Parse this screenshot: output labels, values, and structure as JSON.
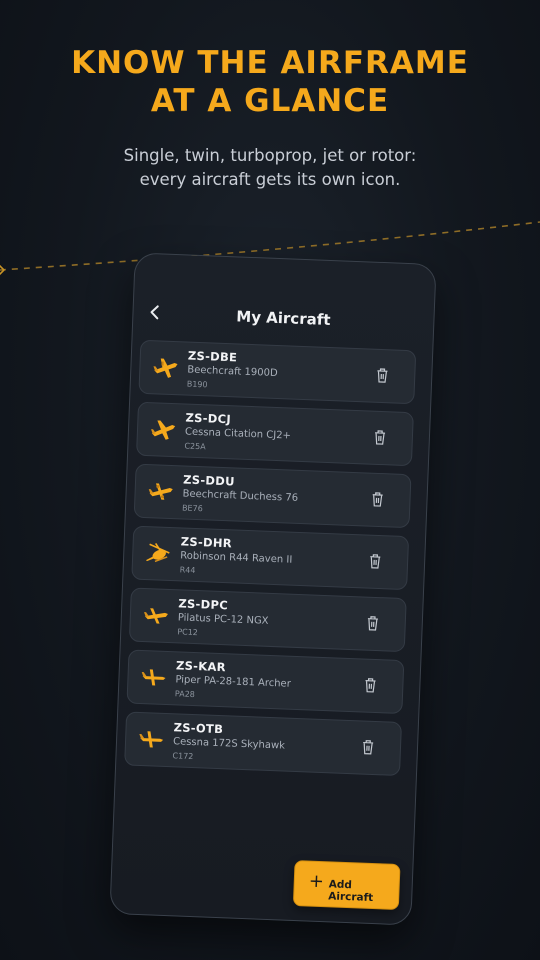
{
  "promo": {
    "headline_line1": "KNOW THE AIRFRAME",
    "headline_line2": "AT A GLANCE",
    "subtitle_line1": "Single, twin, turboprop, jet or rotor:",
    "subtitle_line2": "every aircraft gets its own icon."
  },
  "colors": {
    "accent": "#f5a91c",
    "background": "#12171e",
    "card": "#252b33"
  },
  "screen": {
    "title": "My Aircraft",
    "back_icon": "chevron-left-icon",
    "add_button": {
      "icon": "plus-icon",
      "label": "Add Aircraft"
    },
    "aircraft": [
      {
        "registration": "ZS-DBE",
        "model": "Beechcraft 1900D",
        "type_code": "B190",
        "icon": "twin-turboprop-plane-icon"
      },
      {
        "registration": "ZS-DCJ",
        "model": "Cessna Citation CJ2+",
        "type_code": "C25A",
        "icon": "jet-plane-icon"
      },
      {
        "registration": "ZS-DDU",
        "model": "Beechcraft Duchess 76",
        "type_code": "BE76",
        "icon": "twin-piston-plane-icon"
      },
      {
        "registration": "ZS-DHR",
        "model": "Robinson R44 Raven II",
        "type_code": "R44",
        "icon": "helicopter-icon"
      },
      {
        "registration": "ZS-DPC",
        "model": "Pilatus PC-12 NGX",
        "type_code": "PC12",
        "icon": "turboprop-plane-icon"
      },
      {
        "registration": "ZS-KAR",
        "model": "Piper PA-28-181 Archer",
        "type_code": "PA28",
        "icon": "single-piston-plane-icon"
      },
      {
        "registration": "ZS-OTB",
        "model": "Cessna 172S Skyhawk",
        "type_code": "C172",
        "icon": "single-piston-plane-icon"
      }
    ]
  }
}
